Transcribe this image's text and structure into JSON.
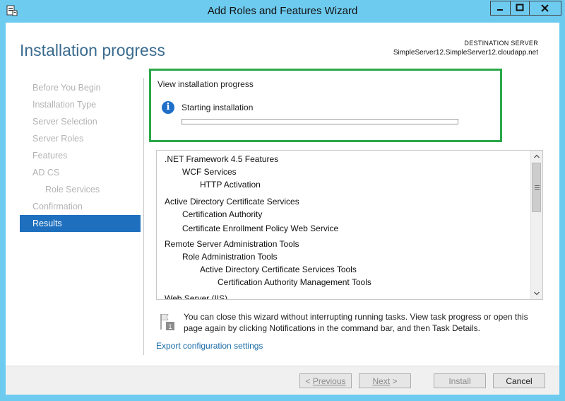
{
  "window": {
    "title": "Add Roles and Features Wizard"
  },
  "header": {
    "page_title": "Installation progress",
    "destination_label": "DESTINATION SERVER",
    "destination_server": "SimpleServer12.SimpleServer12.cloudapp.net"
  },
  "nav": {
    "items": [
      {
        "label": "Before You Begin",
        "state": "disabled"
      },
      {
        "label": "Installation Type",
        "state": "disabled"
      },
      {
        "label": "Server Selection",
        "state": "disabled"
      },
      {
        "label": "Server Roles",
        "state": "disabled"
      },
      {
        "label": "Features",
        "state": "disabled"
      },
      {
        "label": "AD CS",
        "state": "disabled"
      },
      {
        "label": "Role Services",
        "state": "disabled"
      },
      {
        "label": "Confirmation",
        "state": "disabled"
      },
      {
        "label": "Results",
        "state": "active"
      }
    ]
  },
  "progress": {
    "heading": "View installation progress",
    "status": "Starting installation",
    "fraction": 0
  },
  "features_list": [
    {
      "label": ".NET Framework 4.5 Features"
    },
    {
      "label": "WCF Services"
    },
    {
      "label": "HTTP Activation"
    },
    {
      "label": "Active Directory Certificate Services"
    },
    {
      "label": "Certification Authority"
    },
    {
      "label": "Certificate Enrollment Policy Web Service"
    },
    {
      "label": "Remote Server Administration Tools"
    },
    {
      "label": "Role Administration Tools"
    },
    {
      "label": "Active Directory Certificate Services Tools"
    },
    {
      "label": "Certification Authority Management Tools"
    },
    {
      "label": "Web Server (IIS)"
    }
  ],
  "notice": {
    "text": "You can close this wizard without interrupting running tasks. View task progress or open this page again by clicking Notifications in the command bar, and then Task Details.",
    "badge": "1"
  },
  "export_link": "Export configuration settings",
  "footer": {
    "prev_label": "Previous",
    "next_label": "Next",
    "install_label": "Install",
    "cancel_label": "Cancel"
  },
  "colors": {
    "accent": "#1e6fbe",
    "highlight_border": "#2aa84a",
    "title_bar": "#6ecbf0"
  }
}
